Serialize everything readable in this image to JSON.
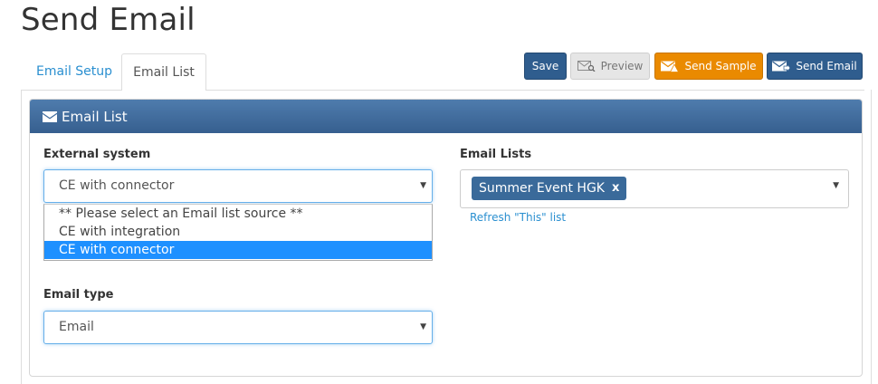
{
  "page": {
    "title": "Send Email"
  },
  "tabs": [
    {
      "label": "Email Setup",
      "active": false
    },
    {
      "label": "Email List",
      "active": true
    }
  ],
  "toolbar": {
    "save_label": "Save",
    "preview_label": "Preview",
    "send_sample_label": "Send Sample",
    "send_email_label": "Send Email"
  },
  "panel": {
    "title": "Email List",
    "external_system": {
      "label": "External system",
      "value": "CE with connector",
      "options": [
        "** Please select an Email list source **",
        "CE with integration",
        "CE with connector"
      ],
      "highlighted_index": 2
    },
    "email_type": {
      "label": "Email type",
      "value": "Email"
    },
    "email_lists": {
      "label": "Email Lists",
      "selected": [
        "Summer Event HGK"
      ],
      "remove_glyph": "x",
      "refresh_link": "Refresh \"This\" list"
    }
  },
  "colors": {
    "primary": "#2f5d8e",
    "warning": "#ea8a00",
    "link": "#2a8fd0",
    "highlight": "#1e90ff"
  }
}
